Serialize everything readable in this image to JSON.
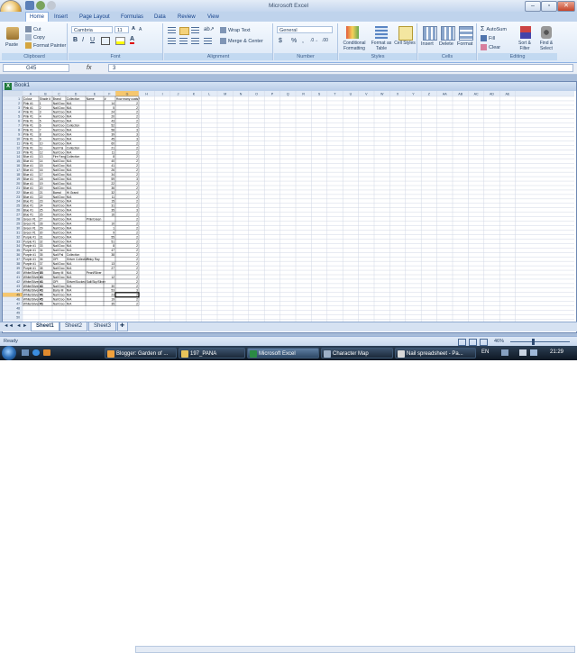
{
  "window": {
    "title": "Microsoft Excel",
    "controls": {
      "minimize": "–",
      "restore": "▫",
      "close": "✕"
    }
  },
  "tabs": [
    "Home",
    "Insert",
    "Page Layout",
    "Formulas",
    "Data",
    "Review",
    "View"
  ],
  "ribbon": {
    "clipboard": {
      "label": "Clipboard",
      "paste": "Paste",
      "cut": "Cut",
      "copy": "Copy",
      "format_painter": "Format Painter"
    },
    "font": {
      "label": "Font",
      "family": "Cambria",
      "size": "11"
    },
    "alignment": {
      "label": "Alignment",
      "wrap": "Wrap Text",
      "merge": "Merge & Center"
    },
    "number": {
      "label": "Number",
      "format": "General",
      "currency": "$",
      "percent": "%"
    },
    "styles": {
      "label": "Styles",
      "conditional": "Conditional Formatting",
      "format_table": "Format as Table",
      "cell_styles": "Cell Styles"
    },
    "cells": {
      "label": "Cells",
      "insert": "Insert",
      "delete": "Delete",
      "format": "Format"
    },
    "editing": {
      "label": "Editing",
      "autosum": "AutoSum",
      "fill": "Fill",
      "clear": "Clear",
      "sort": "Sort & Filter",
      "find": "Find & Select"
    }
  },
  "formula_bar": {
    "name_box": "G45",
    "fx": "fx",
    "value": "3"
  },
  "workbook": {
    "title": "Book1"
  },
  "sheet": {
    "columns": [
      "A",
      "B",
      "C",
      "D",
      "E",
      "F",
      "G",
      "H",
      "I",
      "J",
      "K",
      "L",
      "M",
      "N",
      "O",
      "P",
      "Q",
      "R",
      "S",
      "T",
      "U",
      "V",
      "W",
      "X",
      "Y",
      "Z",
      "AA",
      "AB",
      "AC",
      "AD",
      "AE"
    ],
    "headers": [
      "Colour",
      "Shade #",
      "Brand",
      "Collection",
      "Name",
      "#",
      "How many coats?"
    ],
    "rows": [
      [
        "Pink #1",
        "1",
        "Nail Doo",
        "N/A",
        "",
        "14",
        "2"
      ],
      [
        "Pink #1",
        "2",
        "Nail Doo",
        "N/A",
        "",
        "5",
        "2"
      ],
      [
        "Pink #1",
        "3",
        "Nail Doo",
        "N/A",
        "",
        "24",
        "2"
      ],
      [
        "Pink #1",
        "4",
        "Nail Doo",
        "N/A",
        "",
        "20",
        "2"
      ],
      [
        "Pink #1",
        "5",
        "Nail Doo",
        "N/A",
        "",
        "43",
        "2"
      ],
      [
        "Pink #1",
        "6",
        "Nail Doo",
        "Collection",
        "",
        "52",
        "2"
      ],
      [
        "Pink #1",
        "7",
        "Nail Doo",
        "N/A",
        "",
        "58",
        "3"
      ],
      [
        "Pink #1",
        "8",
        "Nail Doo",
        "N/A",
        "",
        "39",
        "3"
      ],
      [
        "Pink #1",
        "9",
        "Nail Doo",
        "N/A",
        "",
        "45",
        "3"
      ],
      [
        "Pink #1",
        "10",
        "Nail Doo",
        "N/A",
        "",
        "60",
        "2"
      ],
      [
        "Pink #1",
        "11",
        "Nail Pal",
        "Collection",
        "",
        "21",
        "2"
      ],
      [
        "Pink #1",
        "12",
        "Nail Doo",
        "N/A",
        "",
        "11",
        "2"
      ],
      [
        "Blue #1",
        "13",
        "Fire Fang",
        "Collection",
        "",
        "8",
        "2"
      ],
      [
        "Blue #1",
        "14",
        "Nail Doo",
        "N/A",
        "",
        "40",
        "2"
      ],
      [
        "Blue #1",
        "15",
        "Nail Doo",
        "N/A",
        "",
        "41",
        "2"
      ],
      [
        "Blue #1",
        "16",
        "Nail Doo",
        "N/A",
        "",
        "26",
        "2"
      ],
      [
        "Blue #1",
        "17",
        "Nail Doo",
        "N/A",
        "",
        "34",
        "2"
      ],
      [
        "Blue #1",
        "18",
        "Nail Doo",
        "N/A",
        "",
        "59",
        "3"
      ],
      [
        "Blue #1",
        "19",
        "Nail Doo",
        "N/A",
        "",
        "22",
        "2"
      ],
      [
        "Blue #1",
        "20",
        "Nail Doo",
        "N/A",
        "",
        "36",
        "2"
      ],
      [
        "Blue #1",
        "21",
        "Barral",
        "Hi Grand",
        "",
        "32",
        "2"
      ],
      [
        "Blue #1",
        "22",
        "Nail Doo",
        "N/A",
        "",
        "11",
        "2"
      ],
      [
        "Blue #1",
        "23",
        "Nail Doo",
        "N/A",
        "",
        "15",
        "2"
      ],
      [
        "Blue #1",
        "24",
        "Nail Doo",
        "N/A",
        "",
        "31",
        "2"
      ],
      [
        "Blue #1",
        "25",
        "Nail Doo",
        "N/A",
        "",
        "35",
        "3"
      ],
      [
        "Blue #1",
        "26",
        "Nail Doo",
        "N/A",
        "",
        "16",
        "2"
      ],
      [
        "Green #1",
        "27",
        "Nail Doo",
        "N/A",
        "Pink/Green",
        "",
        "2"
      ],
      [
        "Green #1",
        "28",
        "Nail Doo",
        "N/A",
        "",
        "10",
        "2"
      ],
      [
        "Green #1",
        "29",
        "Nail Doo",
        "N/A",
        "",
        "1",
        "2"
      ],
      [
        "Green #1",
        "30",
        "Nail Doo",
        "N/A",
        "",
        "9",
        "2"
      ],
      [
        "Purple #1",
        "31",
        "Nail Doo",
        "N/A",
        "",
        "55",
        "2"
      ],
      [
        "Purple #1",
        "32",
        "Nail Doo",
        "N/A",
        "",
        "51",
        "2"
      ],
      [
        "Purple #1",
        "33",
        "Nail Doo",
        "N/A",
        "",
        "8",
        "2"
      ],
      [
        "Purple #1",
        "34",
        "Nail Doo",
        "N/A",
        "",
        "47",
        "2"
      ],
      [
        "Purple #1",
        "35",
        "Nail Pal",
        "Collection",
        "",
        "38",
        "2"
      ],
      [
        "Purple #1",
        "36",
        "OPI",
        "Shiver Collection",
        "Pinky Ray",
        "",
        "2"
      ],
      [
        "Purple #1",
        "37",
        "Nail Doo",
        "N/A",
        "",
        "13",
        "2"
      ],
      [
        "Purple #1",
        "38",
        "Nail Doo",
        "N/A",
        "",
        "27",
        "2"
      ],
      [
        "White/Silver #1",
        "39",
        "Barry M",
        "N/A",
        "Pearl/Silver",
        "",
        "2"
      ],
      [
        "White/Silver #1",
        "40",
        "Nail Doo",
        "N/A",
        "",
        "12",
        "2"
      ],
      [
        "White/Silver #1",
        "41",
        "OPI",
        "Shiver/Sucked",
        "Sail/Sky/Silver",
        "",
        "2"
      ],
      [
        "White/Silver #1",
        "42",
        "Nail Doo",
        "N/A",
        "",
        "30",
        "2"
      ],
      [
        "White/Silver #1",
        "43",
        "Barry M",
        "N/A",
        "",
        "53",
        "3"
      ],
      [
        "White/Silver #1",
        "44",
        "Nail Doo",
        "N/A",
        "",
        "23",
        "2"
      ],
      [
        "White/Silver #1",
        "45",
        "Nail Doo",
        "N/A",
        "",
        "19",
        "2"
      ],
      [
        "White/Silver #1",
        "46",
        "Nail Doo",
        "N/A",
        "",
        "35",
        "2"
      ]
    ],
    "tabs": [
      "Sheet1",
      "Sheet2",
      "Sheet3"
    ]
  },
  "status_bar": {
    "state": "Ready",
    "zoom": "46%"
  },
  "taskbar": {
    "items": [
      "Blogger: Garden of ...",
      "197_PANA",
      "Microsoft Excel",
      "Character Map",
      "Nail spreadsheet - Pa..."
    ],
    "clock": "21:29"
  },
  "colors": {
    "ribbon_blue": "#dbe7f6",
    "selected_header": "#f6c76e",
    "sheet_grid": "#d0d7e5"
  }
}
